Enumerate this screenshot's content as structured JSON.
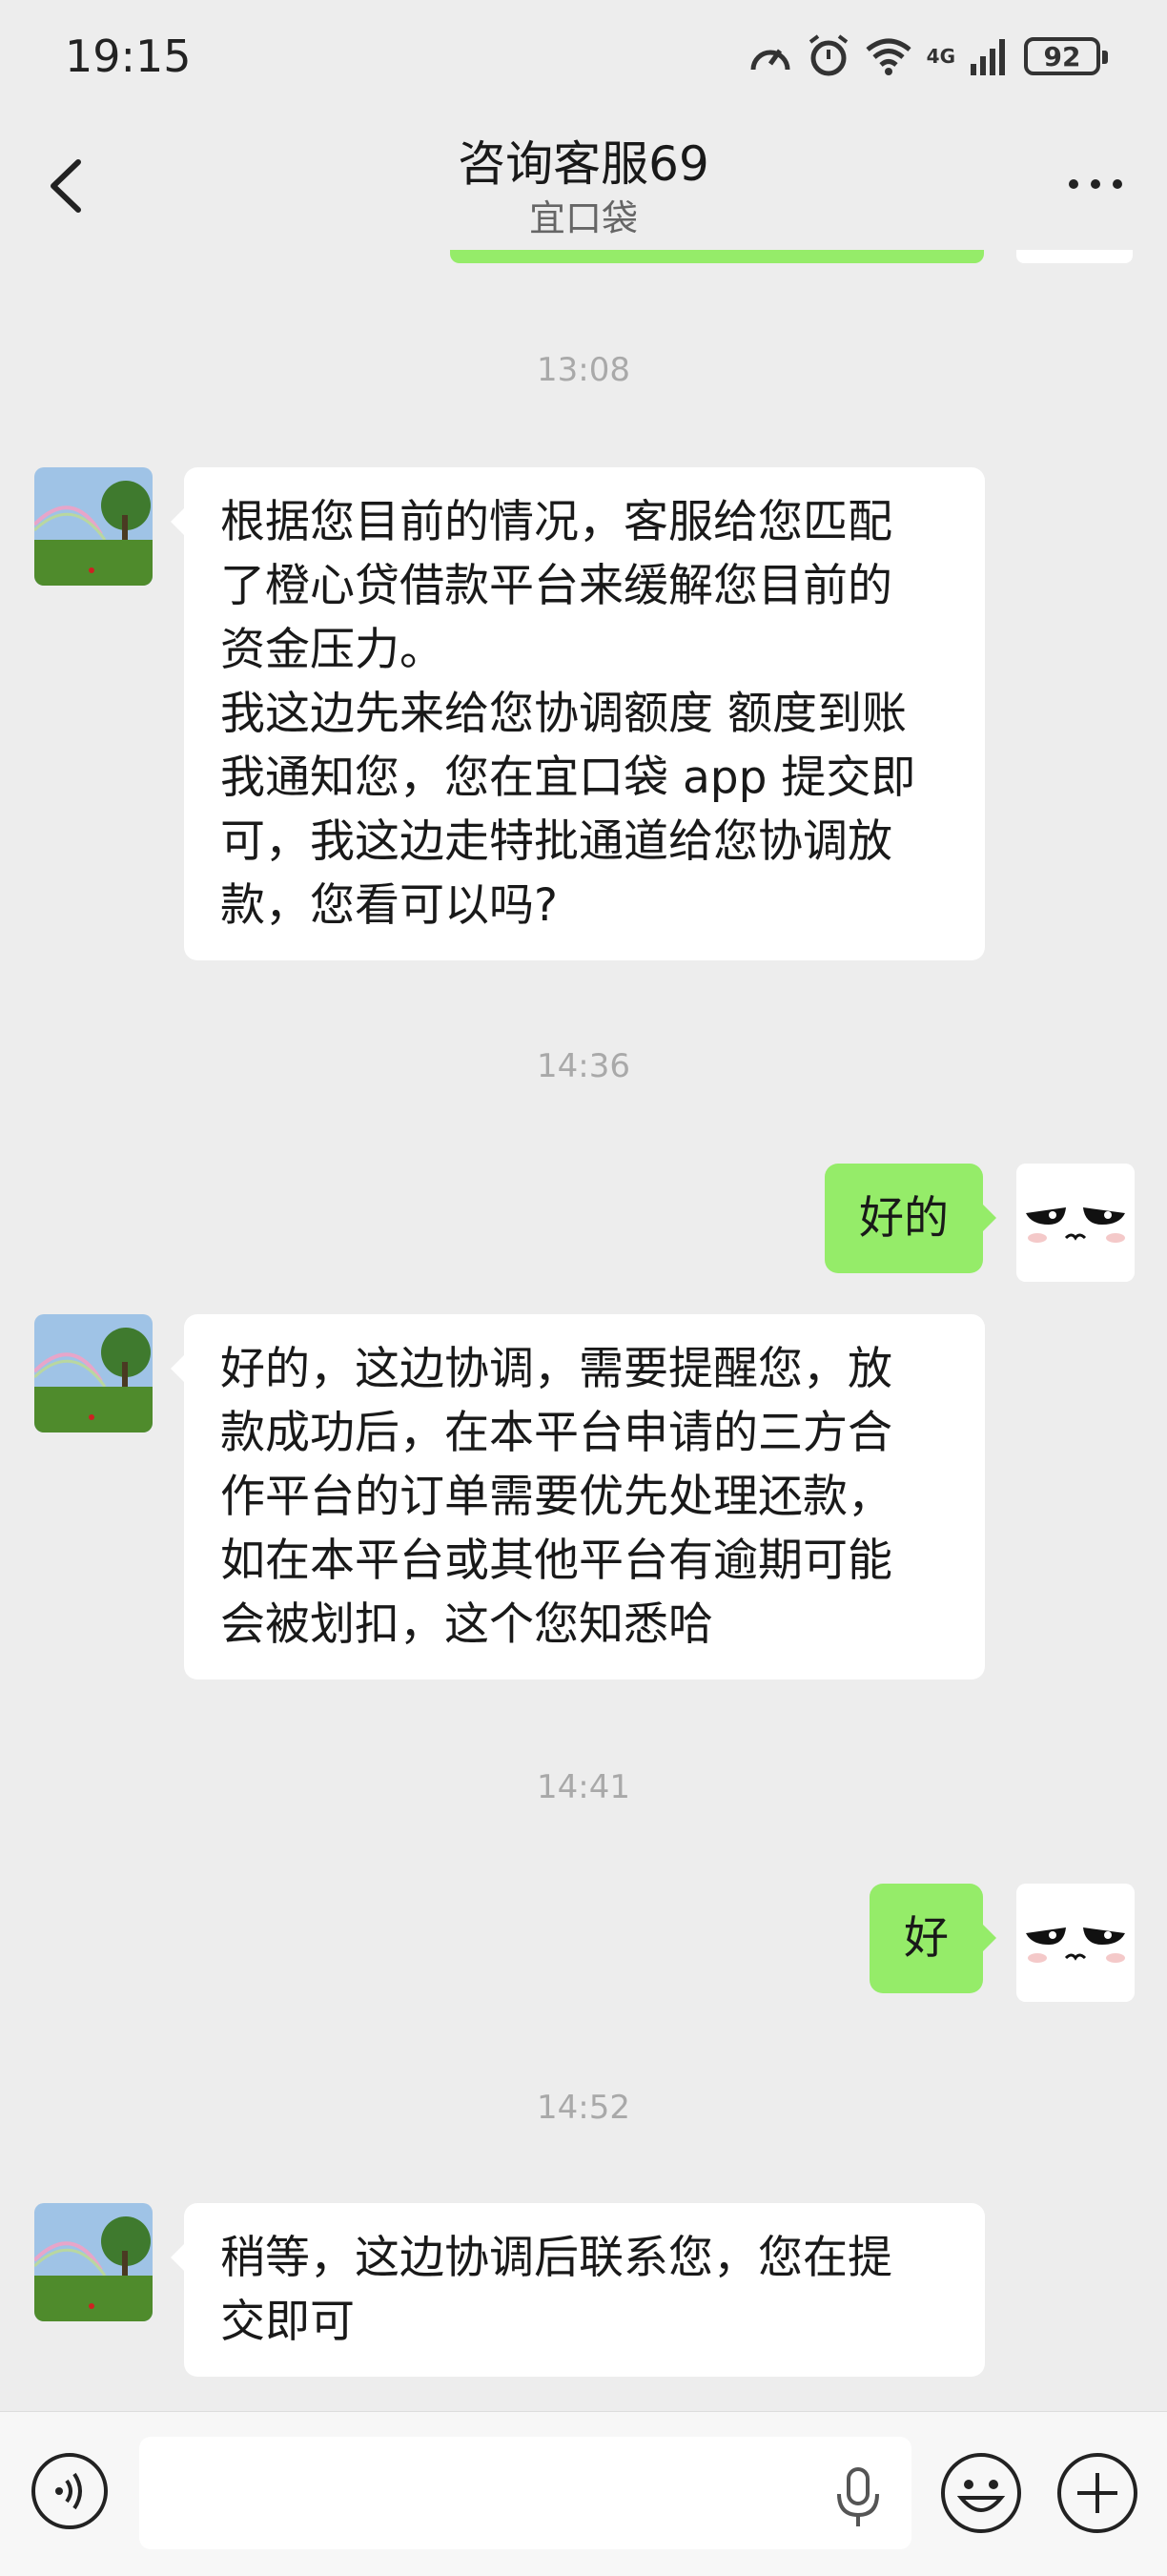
{
  "status_bar": {
    "time": "19:15",
    "battery": "92",
    "network": "4G"
  },
  "header": {
    "title": "咨询客服69",
    "subtitle": "宜口袋"
  },
  "messages": [
    {
      "timestamp": "13:08"
    },
    {
      "lines": [
        "根据您目前的情况，客服给您匹配",
        "了橙心贷借款平台来缓解您目前的",
        "资金压力。",
        "我这边先来给您协调额度 额度到账",
        "我通知您，您在宜口袋 app 提交即",
        "可，我这边走特批通道给您协调放",
        "款，您看可以吗?"
      ]
    },
    {
      "timestamp": "14:36"
    },
    {
      "text": "好的"
    },
    {
      "lines": [
        "好的，这边协调，需要提醒您，放",
        "款成功后，在本平台申请的三方合",
        "作平台的订单需要优先处理还款，",
        "如在本平台或其他平台有逾期可能",
        "会被划扣，这个您知悉哈"
      ]
    },
    {
      "timestamp": "14:41"
    },
    {
      "text": "好"
    },
    {
      "timestamp": "14:52"
    },
    {
      "lines": [
        "稍等，这边协调后联系您，您在提",
        "交即可"
      ]
    }
  ],
  "input": {
    "value": "",
    "placeholder": ""
  },
  "icons": {
    "back": "chevron-left-icon",
    "more": "more-dots-icon",
    "voice": "voice-icon",
    "mic": "mic-icon",
    "emoji": "emoji-icon",
    "plus": "plus-icon"
  },
  "colors": {
    "background": "#ededed",
    "sent_bubble": "#95ec69",
    "received_bubble": "#ffffff",
    "timestamp": "#a9a9a9"
  }
}
